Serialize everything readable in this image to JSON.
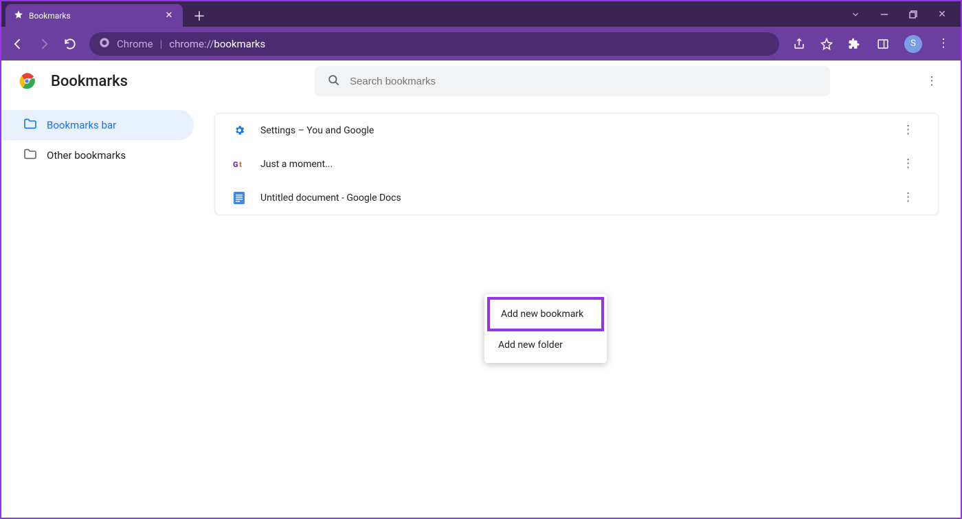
{
  "window": {
    "tab_title": "Bookmarks",
    "avatar_letter": "S"
  },
  "addressbar": {
    "scheme_label": "Chrome",
    "url_prefix": "chrome://",
    "url_path": "bookmarks"
  },
  "page": {
    "title": "Bookmarks",
    "search_placeholder": "Search bookmarks"
  },
  "sidebar": {
    "items": [
      {
        "label": "Bookmarks bar",
        "active": true
      },
      {
        "label": "Other bookmarks",
        "active": false
      }
    ]
  },
  "bookmarks": [
    {
      "label": "Settings – You and Google",
      "icon": "settings"
    },
    {
      "label": "Just a moment...",
      "icon": "gt"
    },
    {
      "label": "Untitled document - Google Docs",
      "icon": "docs"
    }
  ],
  "context_menu": {
    "items": [
      {
        "label": "Add new bookmark",
        "highlighted": true
      },
      {
        "label": "Add new folder",
        "highlighted": false
      }
    ]
  }
}
